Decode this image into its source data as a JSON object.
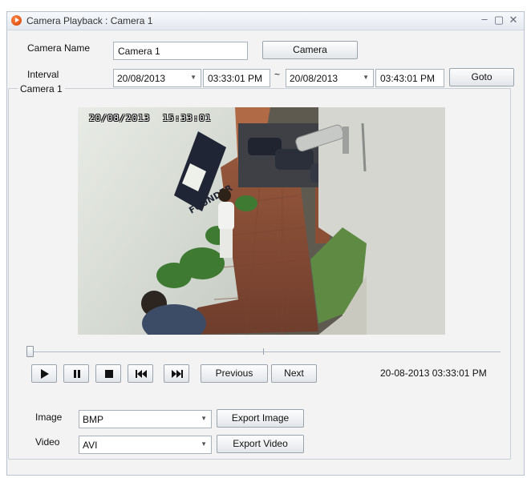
{
  "window": {
    "title": "Camera Playback : Camera 1"
  },
  "form": {
    "camera_name_label": "Camera Name",
    "camera_name_value": "Camera 1",
    "camera_button": "Camera",
    "interval_label": "Interval",
    "start_date": "20/08/2013",
    "start_time": "03:33:01 PM",
    "separator": "~",
    "end_date": "20/08/2013",
    "end_time": "03:43:01 PM",
    "goto_button": "Goto"
  },
  "group": {
    "title": "Camera 1"
  },
  "video": {
    "osd_date": "20/08/2013",
    "osd_time": "15:33:01",
    "wall_logo": "FOUNDER"
  },
  "playback": {
    "progress": 0.0,
    "previous_button": "Previous",
    "next_button": "Next",
    "timestamp": "20-08-2013 03:33:01 PM",
    "icons": [
      "play-icon",
      "pause-icon",
      "stop-icon",
      "rewind-icon",
      "fast-forward-icon"
    ]
  },
  "export": {
    "image_label": "Image",
    "image_format": "BMP",
    "export_image_button": "Export Image",
    "video_label": "Video",
    "video_format": "AVI",
    "export_video_button": "Export Video"
  },
  "colors": {
    "accent": "#d33c00",
    "window_bg": "#f3f3f3",
    "border": "#a8b2bd"
  }
}
